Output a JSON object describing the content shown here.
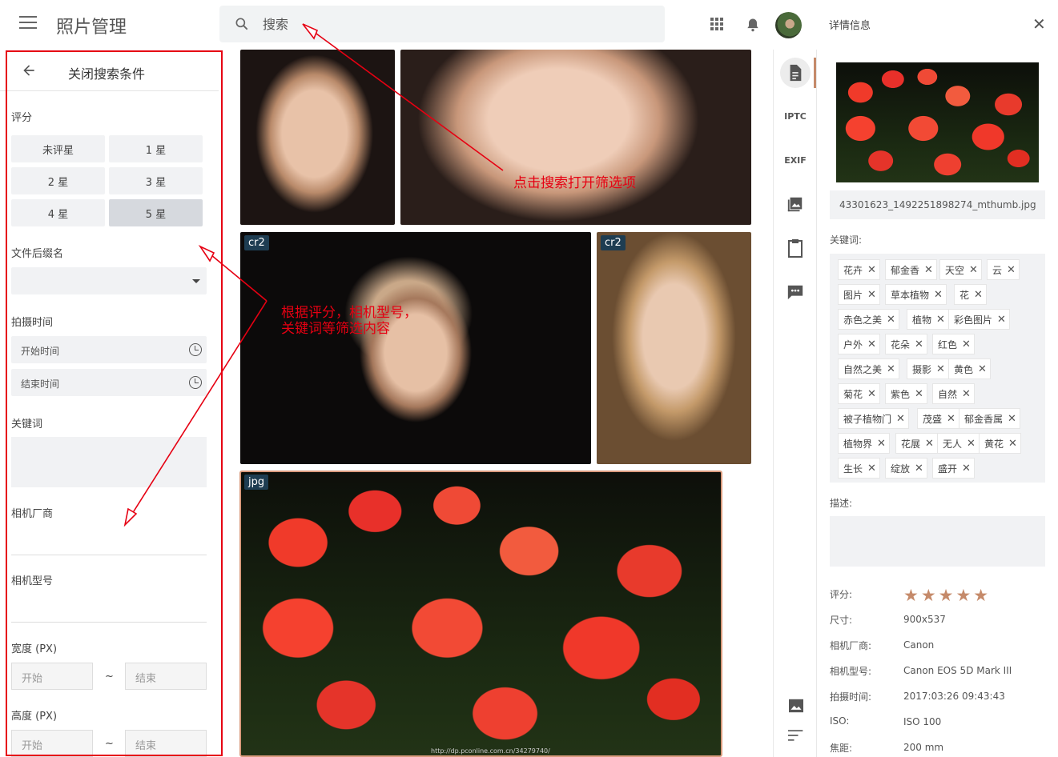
{
  "app": {
    "title": "照片管理"
  },
  "search": {
    "placeholder": "搜索"
  },
  "filter": {
    "header_title": "关闭搜索条件",
    "rating_label": "评分",
    "rating_options": [
      "未评星",
      "1 星",
      "2 星",
      "3 星",
      "4 星",
      "5 星"
    ],
    "rating_selected": "5 星",
    "suffix_label": "文件后缀名",
    "suffix_value": "",
    "time_label": "拍摄时间",
    "start_time_placeholder": "开始时间",
    "end_time_placeholder": "结束时间",
    "keyword_label": "关键词",
    "maker_label": "相机厂商",
    "model_label": "相机型号",
    "width_label": "宽度 (PX)",
    "height_label": "高度 (PX)",
    "start_placeholder": "开始",
    "end_placeholder": "结束",
    "range_sep": "~"
  },
  "grid": {
    "badges": [
      "cr2",
      "cr2",
      "jpg"
    ],
    "watermark": "http://dp.pconline.com.cn/34279740/"
  },
  "side_tabs": [
    "IPTC",
    "EXIF"
  ],
  "detail": {
    "title": "详情信息",
    "filename": "43301623_1492251898274_mthumb.jpg",
    "keywords_label": "关键词:",
    "keywords": [
      "花卉",
      "郁金香",
      "天空",
      "云",
      "图片",
      "草本植物",
      "花",
      "赤色之美",
      "植物",
      "彩色图片",
      "户外",
      "花朵",
      "红色",
      "自然之美",
      "摄影",
      "黄色",
      "菊花",
      "紫色",
      "自然",
      "被子植物门",
      "茂盛",
      "郁金香属",
      "植物界",
      "花展",
      "无人",
      "黄花",
      "生长",
      "绽放",
      "盛开"
    ],
    "description_label": "描述:",
    "rating_label": "评分:",
    "rating_value": 5,
    "rating_stars": "★★★★★",
    "size_label": "尺寸:",
    "size_value": "900x537",
    "maker_label": "相机厂商:",
    "maker_value": "Canon",
    "model_label": "相机型号:",
    "model_value": "Canon EOS 5D Mark III",
    "time_label": "拍摄时间:",
    "time_value": "2017:03:26 09:43:43",
    "iso_label": "ISO:",
    "iso_value": "ISO 100",
    "focal_label": "焦距:",
    "focal_value": "200 mm"
  },
  "annotations": {
    "search_hint": "点击搜索打开筛选项",
    "filter_hint_line1": "根据评分，相机型号，",
    "filter_hint_line2": "关键词等筛选内容",
    "color": "#e60012"
  }
}
